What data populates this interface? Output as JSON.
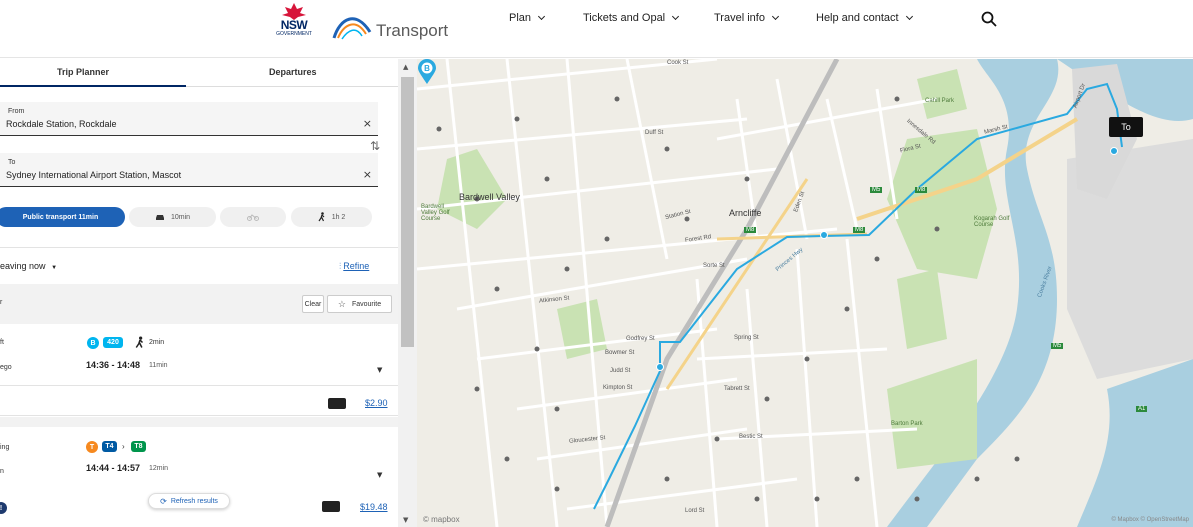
{
  "header": {
    "nsw_brand": "NSW",
    "nsw_sub": "GOVERNMENT",
    "logo_text": "Transport",
    "nav": [
      {
        "label": "Plan"
      },
      {
        "label": "Tickets and Opal"
      },
      {
        "label": "Travel info"
      },
      {
        "label": "Help and contact"
      }
    ]
  },
  "tabs": {
    "trip_planner": "Trip Planner",
    "departures": "Departures"
  },
  "from": {
    "label": "From",
    "value": "Rockdale Station, Rockdale",
    "clear": "×"
  },
  "to": {
    "label": "To",
    "value": "Sydney International Airport Station, Mascot",
    "clear": "×"
  },
  "swap_icon": "⇅",
  "modes": {
    "public_transport": "Public transport  11min",
    "drive": "10min",
    "walk": "1h 2"
  },
  "leaving": "eaving now",
  "refine": "Refine",
  "filter": {
    "left_fragment": "r",
    "clear": "Clear",
    "favourite": "Favourite"
  },
  "trips": [
    {
      "line1": "ft",
      "line2": "ego",
      "bus_route": "420",
      "walk_time": "2min",
      "times": "14:36 - 14:48",
      "duration": "11min",
      "price": "$2.90"
    },
    {
      "line1": "ing",
      "line2": "n",
      "train_a": "T4",
      "train_b": "T8",
      "times": "14:44 - 14:57",
      "duration": "12min",
      "price": "$19.48"
    }
  ],
  "refresh": "Refresh results",
  "map": {
    "labels": {
      "bardwell_valley": "Bardwell Valley",
      "arncliffe": "Arncliffe",
      "cahill_park": "Cahill Park",
      "kogarah_golf": "Kogarah Golf Course",
      "barton_park": "Barton Park",
      "cooks_river": "Cooks River",
      "bardwell_golf": "Bardwell Valley Golf Course",
      "forest_rd": "Forest Rd",
      "princes_hwy": "Princes Hwy",
      "wollongong_rd": "Wollongong Rd",
      "bestic_st": "Bestic St",
      "spring_st": "Spring St",
      "gloucester_st": "Gloucester St",
      "tabrett_st": "Tabrett St",
      "kimpton_st": "Kimpton St",
      "bowmer_st": "Bowmer St",
      "judd_st": "Judd St",
      "godfrey_st": "Godfrey St",
      "atkinson_st": "Atkinson St",
      "station_st": "Station St",
      "duff_st": "Duff St",
      "flora_st": "Flora St",
      "marsh_st": "Marsh St",
      "airport_dr": "Airport Dr",
      "innesdale_rd": "Innesdale Rd",
      "eden_st": "Eden St",
      "lord_st": "Lord St",
      "sorte_st": "Sorte St",
      "m5": "M5",
      "m8": "M8",
      "a1": "A1",
      "cook_st": "Cook St"
    },
    "to_marker": "To",
    "b_marker": "B",
    "mapbox": "© mapbox",
    "attribution": "© Mapbox © OpenStreetMap"
  },
  "colors": {
    "route": "#2aa9e0",
    "primary": "#1e62b6",
    "bus": "#00b5ef",
    "train": "#f6891f",
    "t4": "#005aa3",
    "t8": "#00954c",
    "water": "#a9cfe0",
    "park": "#c9e2b3"
  }
}
